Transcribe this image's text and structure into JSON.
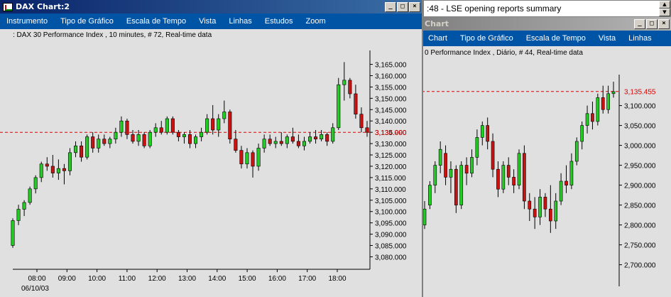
{
  "left_window": {
    "title": "DAX Chart:2",
    "menu": [
      "Instrumento",
      "Tipo de Gráfico",
      "Escala de Tempo",
      "Vista",
      "Linhas",
      "Estudos",
      "Zoom"
    ],
    "subtitle": ": DAX 30 Performance Index , 10 minutes, # 72, Real-time data",
    "date_label": "06/10/03",
    "last_price": "3,134.990"
  },
  "right_window": {
    "title": "Chart",
    "menu": [
      "Chart",
      "Tipo de Gráfico",
      "Escala de Tempo",
      "Vista",
      "Linhas"
    ],
    "subtitle": "0 Performance Index , Diário, # 44, Real-time data",
    "last_price": "3,135.455"
  },
  "news_bar": {
    "text": ":48 - LSE opening reports summary"
  },
  "window_buttons": {
    "minimize": "_",
    "maximize": "□",
    "close": "×"
  },
  "chart_data": [
    {
      "type": "candlestick",
      "title": "DAX 30 Performance Index , 10 minutes, # 72, Real-time data",
      "x_ticks": [
        "08:00",
        "09:00",
        "10:00",
        "11:00",
        "12:00",
        "13:00",
        "14:00",
        "15:00",
        "16:00",
        "17:00",
        "18:00"
      ],
      "y_ticks": [
        3080,
        3085,
        3090,
        3095,
        3100,
        3105,
        3110,
        3115,
        3120,
        3125,
        3130,
        3135,
        3140,
        3145,
        3150,
        3155,
        3160,
        3165
      ],
      "y_tick_labels": [
        "3,080.000",
        "3,085.000",
        "3,090.000",
        "3,095.000",
        "3,100.000",
        "3,105.000",
        "3,110.000",
        "3,115.000",
        "3,120.000",
        "3,125.000",
        "3,130.000",
        "3,135.000",
        "3,140.000",
        "3,145.000",
        "3,150.000",
        "3,155.000",
        "3,160.000",
        "3,165.000"
      ],
      "ylim": [
        3077,
        3168
      ],
      "reference_line": 3134.99,
      "reference_label": "3,134.990",
      "candles": [
        [
          3085,
          3097,
          3084,
          3096
        ],
        [
          3096,
          3103,
          3094,
          3101
        ],
        [
          3101,
          3105,
          3098,
          3104
        ],
        [
          3104,
          3111,
          3103,
          3110
        ],
        [
          3110,
          3116,
          3108,
          3115
        ],
        [
          3115,
          3122,
          3113,
          3121
        ],
        [
          3121,
          3124,
          3118,
          3120
        ],
        [
          3120,
          3125,
          3115,
          3117
        ],
        [
          3117,
          3123,
          3114,
          3119
        ],
        [
          3119,
          3121,
          3112,
          3118
        ],
        [
          3118,
          3128,
          3116,
          3126
        ],
        [
          3126,
          3131,
          3124,
          3129
        ],
        [
          3129,
          3131,
          3122,
          3124
        ],
        [
          3124,
          3134,
          3123,
          3133
        ],
        [
          3133,
          3135,
          3126,
          3128
        ],
        [
          3128,
          3134,
          3126,
          3132
        ],
        [
          3132,
          3134,
          3129,
          3130
        ],
        [
          3130,
          3133,
          3128,
          3132
        ],
        [
          3132,
          3137,
          3130,
          3135
        ],
        [
          3135,
          3142,
          3133,
          3140
        ],
        [
          3140,
          3141,
          3132,
          3134
        ],
        [
          3134,
          3136,
          3130,
          3131
        ],
        [
          3131,
          3136,
          3129,
          3134
        ],
        [
          3134,
          3135,
          3128,
          3129
        ],
        [
          3129,
          3136,
          3128,
          3135
        ],
        [
          3135,
          3139,
          3133,
          3137
        ],
        [
          3137,
          3140,
          3134,
          3135
        ],
        [
          3135,
          3142,
          3134,
          3141
        ],
        [
          3141,
          3142,
          3134,
          3135
        ],
        [
          3135,
          3136,
          3131,
          3133
        ],
        [
          3133,
          3135,
          3130,
          3134
        ],
        [
          3134,
          3136,
          3128,
          3130
        ],
        [
          3130,
          3134,
          3128,
          3133
        ],
        [
          3133,
          3137,
          3131,
          3135
        ],
        [
          3135,
          3143,
          3134,
          3141
        ],
        [
          3141,
          3147,
          3134,
          3136
        ],
        [
          3136,
          3143,
          3133,
          3141
        ],
        [
          3141,
          3149,
          3139,
          3144
        ],
        [
          3144,
          3145,
          3130,
          3132
        ],
        [
          3132,
          3136,
          3126,
          3127
        ],
        [
          3127,
          3129,
          3119,
          3121
        ],
        [
          3121,
          3128,
          3119,
          3126
        ],
        [
          3126,
          3127,
          3115,
          3120
        ],
        [
          3120,
          3130,
          3118,
          3128
        ],
        [
          3128,
          3134,
          3126,
          3132
        ],
        [
          3132,
          3134,
          3129,
          3130
        ],
        [
          3130,
          3133,
          3128,
          3131
        ],
        [
          3131,
          3135,
          3129,
          3130
        ],
        [
          3130,
          3134,
          3128,
          3133
        ],
        [
          3133,
          3137,
          3130,
          3131
        ],
        [
          3131,
          3134,
          3128,
          3129
        ],
        [
          3129,
          3133,
          3127,
          3131
        ],
        [
          3131,
          3135,
          3130,
          3133
        ],
        [
          3133,
          3136,
          3130,
          3132
        ],
        [
          3132,
          3136,
          3131,
          3134
        ],
        [
          3134,
          3135,
          3129,
          3131
        ],
        [
          3131,
          3139,
          3130,
          3137
        ],
        [
          3137,
          3159,
          3136,
          3156
        ],
        [
          3156,
          3166,
          3149,
          3158
        ],
        [
          3158,
          3159,
          3150,
          3152
        ],
        [
          3152,
          3156,
          3141,
          3143
        ],
        [
          3143,
          3146,
          3135,
          3137
        ],
        [
          3137,
          3140,
          3133,
          3135
        ]
      ]
    },
    {
      "type": "candlestick",
      "title": "0 Performance Index , Diário, # 44, Real-time data",
      "y_ticks": [
        2700,
        2750,
        2800,
        2850,
        2900,
        2950,
        3000,
        3050,
        3100
      ],
      "y_tick_labels": [
        "2,700.000",
        "2,750.000",
        "2,800.000",
        "2,850.000",
        "2,900.000",
        "2,950.000",
        "3,000.000",
        "3,050.000",
        "3,100.000"
      ],
      "ylim": [
        2660,
        3160
      ],
      "reference_line": 3135.455,
      "reference_label": "3,135.455",
      "candles": [
        [
          2800,
          2860,
          2790,
          2840
        ],
        [
          2850,
          2910,
          2840,
          2900
        ],
        [
          2900,
          2960,
          2880,
          2950
        ],
        [
          2950,
          3010,
          2930,
          2990
        ],
        [
          2980,
          3000,
          2900,
          2920
        ],
        [
          2920,
          2960,
          2880,
          2940
        ],
        [
          2940,
          2950,
          2830,
          2850
        ],
        [
          2850,
          2960,
          2840,
          2950
        ],
        [
          2950,
          2970,
          2900,
          2930
        ],
        [
          2930,
          2990,
          2920,
          2970
        ],
        [
          2970,
          3040,
          2950,
          3020
        ],
        [
          3020,
          3060,
          3000,
          3050
        ],
        [
          3050,
          3070,
          2990,
          3010
        ],
        [
          3010,
          3030,
          2920,
          2940
        ],
        [
          2940,
          2960,
          2870,
          2890
        ],
        [
          2890,
          2960,
          2880,
          2950
        ],
        [
          2950,
          2970,
          2900,
          2920
        ],
        [
          2920,
          2940,
          2880,
          2900
        ],
        [
          2900,
          2990,
          2890,
          2980
        ],
        [
          2980,
          3000,
          2840,
          2860
        ],
        [
          2860,
          2880,
          2810,
          2840
        ],
        [
          2840,
          2870,
          2790,
          2820
        ],
        [
          2820,
          2890,
          2800,
          2870
        ],
        [
          2870,
          2880,
          2820,
          2840
        ],
        [
          2840,
          2900,
          2780,
          2810
        ],
        [
          2810,
          2880,
          2790,
          2860
        ],
        [
          2860,
          2930,
          2850,
          2910
        ],
        [
          2910,
          2950,
          2880,
          2900
        ],
        [
          2900,
          2980,
          2890,
          2960
        ],
        [
          2960,
          3020,
          2950,
          3010
        ],
        [
          3010,
          3060,
          2990,
          3050
        ],
        [
          3050,
          3100,
          3030,
          3080
        ],
        [
          3080,
          3110,
          3040,
          3060
        ],
        [
          3060,
          3130,
          3050,
          3120
        ],
        [
          3120,
          3150,
          3080,
          3090
        ],
        [
          3090,
          3150,
          3080,
          3130
        ],
        [
          3130,
          3160,
          3120,
          3135
        ]
      ]
    }
  ]
}
